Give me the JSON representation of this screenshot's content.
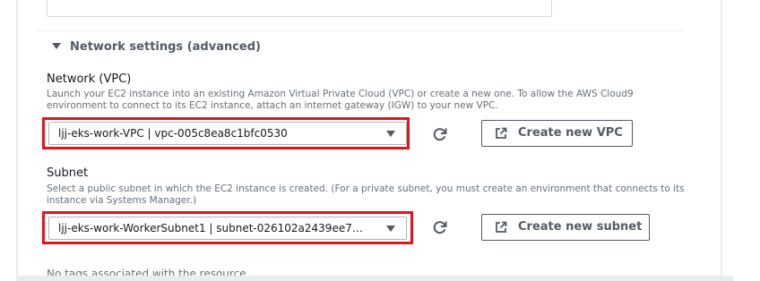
{
  "section": {
    "title": "Network settings (advanced)"
  },
  "network": {
    "label": "Network (VPC)",
    "description": "Launch your EC2 instance into an existing Amazon Virtual Private Cloud (VPC) or create a new one. To allow the AWS Cloud9 environment to connect to its EC2 instance, attach an internet gateway (IGW) to your new VPC.",
    "selected": "ljj-eks-work-VPC | vpc-005c8ea8c1bfc0530",
    "create_label": "Create new VPC"
  },
  "subnet": {
    "label": "Subnet",
    "description": "Select a public subnet in which the EC2 instance is created. (For a private subnet, you must create an environment that connects to its instance via Systems Manager.)",
    "selected": "ljj-eks-work-WorkerSubnet1 | subnet-026102a2439ee7…",
    "create_label": "Create new subnet"
  },
  "tags": {
    "empty_text": "No tags associated with the resource"
  },
  "colors": {
    "highlight": "#e3141e",
    "text": "#16191f",
    "muted": "#687078",
    "button_border": "#545b64"
  },
  "icons": {
    "collapse": "caret-down-icon",
    "refresh": "refresh-icon",
    "external": "external-link-icon",
    "dropdown": "dropdown-arrow-icon"
  }
}
